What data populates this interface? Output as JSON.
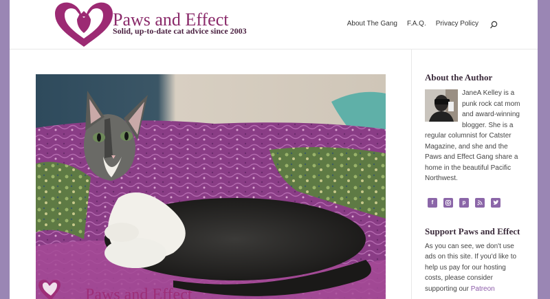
{
  "header": {
    "logo_title": "Paws and Effect",
    "logo_tagline": "Solid, up-to-date cat advice since 2003"
  },
  "nav": {
    "items": [
      "About The Gang",
      "F.A.Q.",
      "Privacy Policy"
    ],
    "search_icon": "search-icon"
  },
  "post": {
    "watermark_text": "Paws and Effect"
  },
  "sidebar": {
    "author_title": "About the Author",
    "author_text": "JaneA Kelley is a punk rock cat mom and award-winning blogger. She is a regular columnist for Catster Magazine, and she and the Paws and Effect Gang share a home in the beautiful Pacific Northwest.",
    "socials": [
      "facebook-icon",
      "instagram-icon",
      "pinterest-icon",
      "rss-icon",
      "twitter-icon"
    ],
    "support_title": "Support Paws and Effect",
    "support_text": "As you can see, we don't use ads on this site. If you'd like to help us pay for our hosting costs, please consider supporting our",
    "support_link": "Patreon"
  },
  "colors": {
    "brand": "#8a2a6a",
    "accent": "#8b66a8",
    "background": "#9a86b4"
  }
}
